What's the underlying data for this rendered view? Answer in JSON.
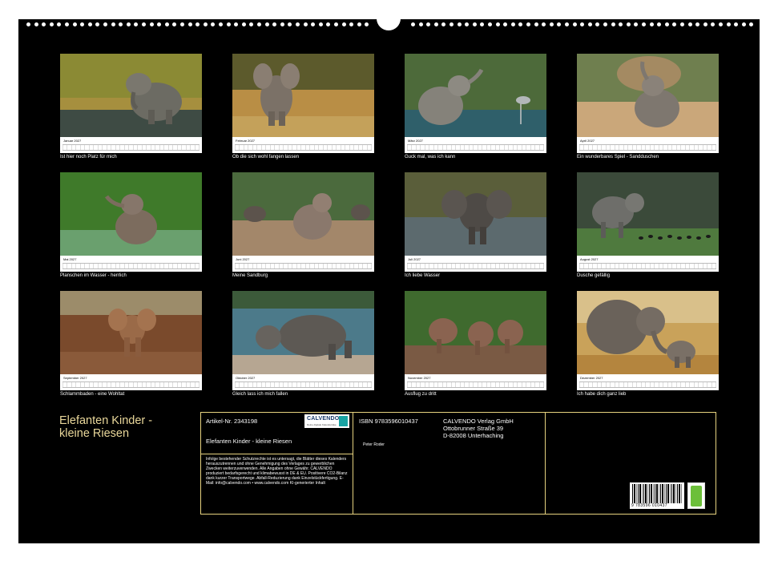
{
  "calendar": {
    "title": "Elefanten Kinder - kleine Riesen",
    "months": [
      {
        "name": "Januar 2027",
        "caption": "Ist hier noch Platz für mich"
      },
      {
        "name": "Februar 2027",
        "caption": "Ob die sich wohl fangen lassen"
      },
      {
        "name": "März 2027",
        "caption": "Guck mal, was ich kann"
      },
      {
        "name": "April 2027",
        "caption": "Ein wunderbares Spiel - Sandduschen"
      },
      {
        "name": "Mai 2027",
        "caption": "Planschen im Wasser - herrlich"
      },
      {
        "name": "Juni 2027",
        "caption": "Meine Sandburg"
      },
      {
        "name": "Juli 2027",
        "caption": "Ich liebe Wasser"
      },
      {
        "name": "August 2027",
        "caption": "Dusche gefällig"
      },
      {
        "name": "September 2027",
        "caption": "Schlammbaden - eine Wohltat"
      },
      {
        "name": "Oktober 2027",
        "caption": "Gleich lass ich mich fallen"
      },
      {
        "name": "November 2027",
        "caption": "Ausflug zu dritt"
      },
      {
        "name": "Dezember 2027",
        "caption": "Ich habe dich ganz lieb"
      }
    ]
  },
  "info": {
    "article": "Artikel-Nr. 2343198",
    "product_title": "Elefanten Kinder - kleine Riesen",
    "isbn": "ISBN 9783596010437",
    "publisher_name": "CALVENDO Verlag GmbH",
    "publisher_street": "Ottobrunner Straße 39",
    "publisher_city": "D-82008 Unterhaching",
    "author": "Peter Roder",
    "legal": "Infolge bestehender Schutzrechte ist es untersagt, die Blätter dieses Kalenders herauszutrennen und ohne Genehmigung des Verlages zu gewerblichen Zwecken weiterzuverwenden. Alle Angaben ohne Gewähr. CALVENDO produziert bedarfsgerecht und klimabewusst in DE & EU. Positivere CO2-Bilanz dank kurzer Transportwege. Abfall-Reduzierung dank Einzelstückfertigung. E-Mail: info@calvendo.com • www.calvendo.com KI-generierter Inhalt",
    "logo_text": "CALVENDO",
    "logo_sub": "Deine digitale Kalenderidee",
    "barcode_number": "9 783596 010437"
  },
  "colors": {
    "background": "#000000",
    "title": "#e9d79a",
    "frame": "#e6d27f"
  }
}
